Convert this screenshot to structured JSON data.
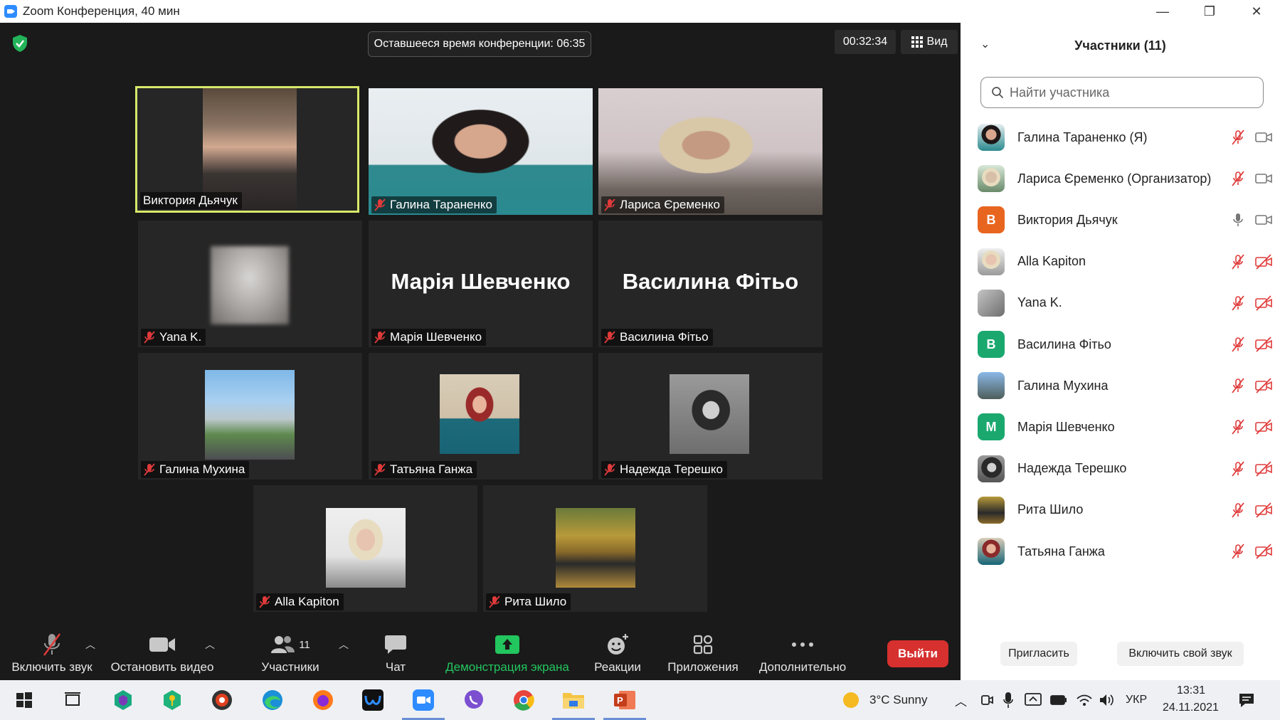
{
  "window": {
    "title": "Zoom Конференция, 40 мин",
    "minimize": "—",
    "maximize": "❐",
    "close": "✕"
  },
  "meeting": {
    "remaining_time": "Оставшееся время конференции: 06:35",
    "elapsed": "00:32:34",
    "view_label": "Вид",
    "tiles": [
      {
        "name": "Виктория Дьячук",
        "muted": false,
        "active": true
      },
      {
        "name": "Галина Тараненко",
        "muted": true
      },
      {
        "name": "Лариса Єременко",
        "muted": true
      },
      {
        "name": "Yana K.",
        "muted": true
      },
      {
        "name": "Марія Шевченко",
        "muted": true,
        "big_name": "Марія Шевченко"
      },
      {
        "name": "Василина Фітьо",
        "muted": true,
        "big_name": "Василина Фітьо"
      },
      {
        "name": "Галина Мухина",
        "muted": true
      },
      {
        "name": "Татьяна Ганжа",
        "muted": true
      },
      {
        "name": "Надежда Терешко",
        "muted": true
      },
      {
        "name": "Alla Kapiton",
        "muted": true
      },
      {
        "name": "Рита Шило",
        "muted": true
      }
    ]
  },
  "toolbar": {
    "unmute": "Включить звук",
    "stop_video": "Остановить видео",
    "participants": "Участники",
    "participants_count": "11",
    "chat": "Чат",
    "share_screen": "Демонстрация экрана",
    "reactions": "Реакции",
    "apps": "Приложения",
    "more": "Дополнительно",
    "leave": "Выйти"
  },
  "panel": {
    "title": "Участники (11)",
    "search_placeholder": "Найти участника",
    "participants": [
      {
        "name": "Галина Тараненко (Я)",
        "avatar": "photo",
        "mic": "muted",
        "video": "on"
      },
      {
        "name": "Лариса Єременко (Организатор)",
        "avatar": "photo",
        "mic": "muted",
        "video": "on"
      },
      {
        "name": "Виктория Дьячук",
        "avatar": "В",
        "avatar_color": "#e8651f",
        "mic": "on",
        "video": "on"
      },
      {
        "name": "Alla Kapiton",
        "avatar": "photo",
        "mic": "muted",
        "video": "off"
      },
      {
        "name": "Yana K.",
        "avatar": "photo",
        "mic": "muted",
        "video": "off"
      },
      {
        "name": "Василина Фітьо",
        "avatar": "В",
        "avatar_color": "#1aa86f",
        "mic": "muted",
        "video": "off"
      },
      {
        "name": "Галина Мухина",
        "avatar": "photo",
        "mic": "muted",
        "video": "off"
      },
      {
        "name": "Марія Шевченко",
        "avatar": "М",
        "avatar_color": "#1aa86f",
        "mic": "muted",
        "video": "off"
      },
      {
        "name": "Надежда Терешко",
        "avatar": "photo",
        "mic": "muted",
        "video": "off"
      },
      {
        "name": "Рита Шило",
        "avatar": "photo",
        "mic": "muted",
        "video": "off"
      },
      {
        "name": "Татьяна Ганжа",
        "avatar": "photo",
        "mic": "muted",
        "video": "off"
      }
    ],
    "invite": "Пригласить",
    "unmute_me": "Включить свой звук"
  },
  "taskbar": {
    "weather": "3°C  Sunny",
    "lang": "УКР",
    "time": "13:31",
    "date": "24.11.2021"
  },
  "colors": {
    "active_border": "#d8e96a",
    "muted_red": "#e03a3a",
    "share_green": "#22c55e",
    "leave_red": "#d6302f"
  }
}
